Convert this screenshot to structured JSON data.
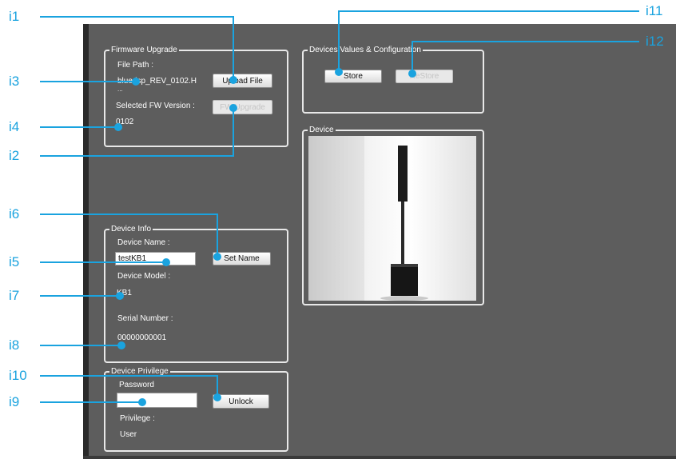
{
  "callouts": [
    "i1",
    "i2",
    "i3",
    "i4",
    "i5",
    "i6",
    "i7",
    "i8",
    "i9",
    "i10",
    "i11",
    "i12"
  ],
  "firmware": {
    "legend": "Firmware Upgrade",
    "file_path_label": "File Path :",
    "file_path_value": "bluedsp_REV_0102.H",
    "file_path_overflow": "...",
    "upload_button": "Upload File",
    "selected_fw_label": "Selected FW Version :",
    "selected_fw_value": "0102",
    "fw_upgrade_button": "FW Upgrade"
  },
  "device_values": {
    "legend": "Devices Values & Configuration",
    "store_button": "Store",
    "restore_button": "ReStore"
  },
  "device": {
    "legend": "Device"
  },
  "device_info": {
    "legend": "Device Info",
    "name_label": "Device Name :",
    "name_value": "testKB1",
    "set_name_button": "Set Name",
    "model_label": "Device Model :",
    "model_value": "KB1",
    "serial_label": "Serial Number :",
    "serial_value": "00000000001"
  },
  "privilege": {
    "legend": "Device Privilege",
    "password_label": "Password",
    "password_value": "",
    "unlock_button": "Unlock",
    "privilege_label": "Privilege :",
    "privilege_value": "User"
  },
  "colors": {
    "callout": "#1aa3df",
    "panel": "#5d5d5d",
    "border": "#e8e8e8"
  }
}
